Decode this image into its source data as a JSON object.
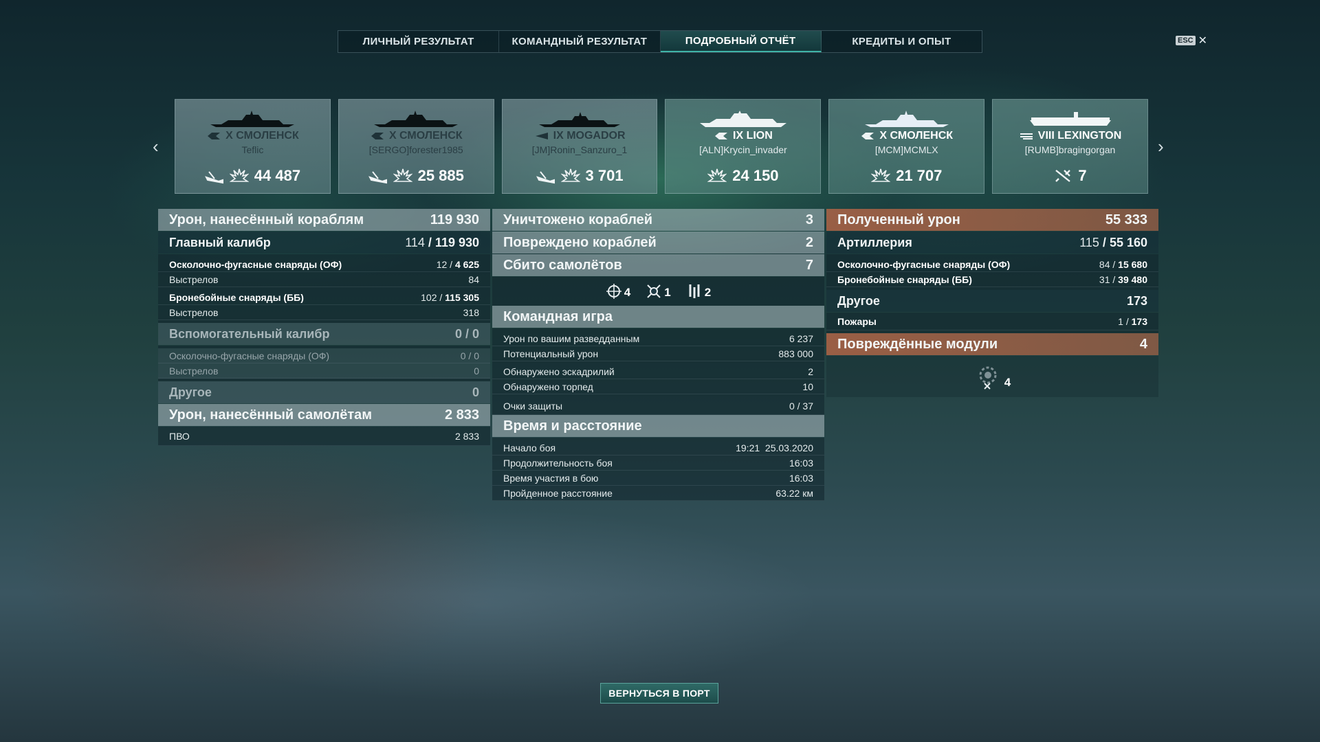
{
  "tabs": [
    {
      "label": "ЛИЧНЫЙ РЕЗУЛЬТАТ",
      "active": false
    },
    {
      "label": "КОМАНДНЫЙ РЕЗУЛЬТАТ",
      "active": false
    },
    {
      "label": "ПОДРОБНЫЙ ОТЧЁТ",
      "active": true
    },
    {
      "label": "КРЕДИТЫ И ОПЫТ",
      "active": false
    }
  ],
  "esc": {
    "key": "ESC",
    "close": "✕"
  },
  "nav": {
    "prev": "‹",
    "next": "›"
  },
  "ships": [
    {
      "name": "X СМОЛЕНСК",
      "player": "Teflic",
      "value": "44 487",
      "status": "destroyed",
      "icons": [
        "torpedo-hit-icon",
        "damage-icon"
      ]
    },
    {
      "name": "X СМОЛЕНСК",
      "player": "[SERGO]forester1985",
      "value": "25 885",
      "status": "destroyed",
      "icons": [
        "torpedo-hit-icon",
        "damage-icon"
      ]
    },
    {
      "name": "IX MOGADOR",
      "player": "[JM]Ronin_Sanzuro_1",
      "value": "3 701",
      "status": "destroyed",
      "icons": [
        "torpedo-hit-icon",
        "damage-icon"
      ]
    },
    {
      "name": "IX LION",
      "player": "[ALN]Krycin_invader",
      "value": "24 150",
      "status": "alive",
      "icons": [
        "damage-icon"
      ]
    },
    {
      "name": "X СМОЛЕНСК",
      "player": "[MCM]MCMLX",
      "value": "21 707",
      "status": "alive",
      "icons": [
        "damage-icon"
      ]
    },
    {
      "name": "VIII LEXINGTON",
      "player": "[RUMB]bragingorgan",
      "value": "7",
      "status": "alive",
      "icons": [
        "planes-shot-icon"
      ]
    }
  ],
  "col1": {
    "damage_ships": {
      "label": "Урон, нанесённый кораблям",
      "value": "119 930"
    },
    "main_battery": {
      "label": "Главный калибр",
      "hits": "114",
      "value": "119 930"
    },
    "he": {
      "label": "Осколочно-фугасные снаряды (ОФ)",
      "hits": "12",
      "value": "4 625"
    },
    "he_shots": {
      "label": "Выстрелов",
      "value": "84"
    },
    "ap": {
      "label": "Бронебойные снаряды (ББ)",
      "hits": "102",
      "value": "115 305"
    },
    "ap_shots": {
      "label": "Выстрелов",
      "value": "318"
    },
    "secondary": {
      "label": "Вспомогательный калибр",
      "value": "0 / 0"
    },
    "sec_he": {
      "label": "Осколочно-фугасные снаряды (ОФ)",
      "value": "0 / 0"
    },
    "sec_shots": {
      "label": "Выстрелов",
      "value": "0"
    },
    "other": {
      "label": "Другое",
      "value": "0"
    },
    "damage_planes": {
      "label": "Урон, нанесённый самолётам",
      "value": "2 833"
    },
    "aa": {
      "label": "ПВО",
      "value": "2 833"
    }
  },
  "col2": {
    "destroyed": {
      "label": "Уничтожено кораблей",
      "value": "3"
    },
    "damaged": {
      "label": "Повреждено кораблей",
      "value": "2"
    },
    "planes": {
      "label": "Сбито самолётов",
      "value": "7"
    },
    "plane_types": [
      {
        "icon": "fighter-target-icon",
        "count": "4"
      },
      {
        "icon": "attack-plane-icon",
        "count": "1"
      },
      {
        "icon": "bomber-icon",
        "count": "2"
      }
    ],
    "team": {
      "label": "Командная игра"
    },
    "spotting_damage": {
      "label": "Урон по вашим разведданным",
      "value": "6 237"
    },
    "potential": {
      "label": "Потенциальный урон",
      "value": "883 000"
    },
    "squadrons": {
      "label": "Обнаружено эскадрилий",
      "value": "2"
    },
    "torpedoes": {
      "label": "Обнаружено торпед",
      "value": "10"
    },
    "defense": {
      "label": "Очки защиты",
      "value": "0 / 37"
    },
    "time": {
      "label": "Время и расстояние"
    },
    "start": {
      "label": "Начало боя",
      "value": "19:21  25.03.2020"
    },
    "duration": {
      "label": "Продолжительность боя",
      "value": "16:03"
    },
    "participation": {
      "label": "Время участия в бою",
      "value": "16:03"
    },
    "distance": {
      "label": "Пройденное расстояние",
      "value": "63.22 км"
    }
  },
  "col3": {
    "received": {
      "label": "Полученный урон",
      "value": "55 333"
    },
    "artillery": {
      "label": "Артиллерия",
      "hits": "115",
      "value": "55 160"
    },
    "he": {
      "label": "Осколочно-фугасные снаряды (ОФ)",
      "hits": "84",
      "value": "15 680"
    },
    "ap": {
      "label": "Бронебойные снаряды (ББ)",
      "hits": "31",
      "value": "39 480"
    },
    "other": {
      "label": "Другое",
      "value": "173"
    },
    "fires": {
      "label": "Пожары",
      "hits": "1",
      "value": "173"
    },
    "modules": {
      "label": "Повреждённые модули",
      "value": "4"
    },
    "module_icon": {
      "icon": "damaged-module-icon",
      "count": "4"
    }
  },
  "back_button": "ВЕРНУТЬСЯ В ПОРТ",
  "colors": {
    "accent": "#3fb4a8",
    "orange": "#b0654a"
  }
}
